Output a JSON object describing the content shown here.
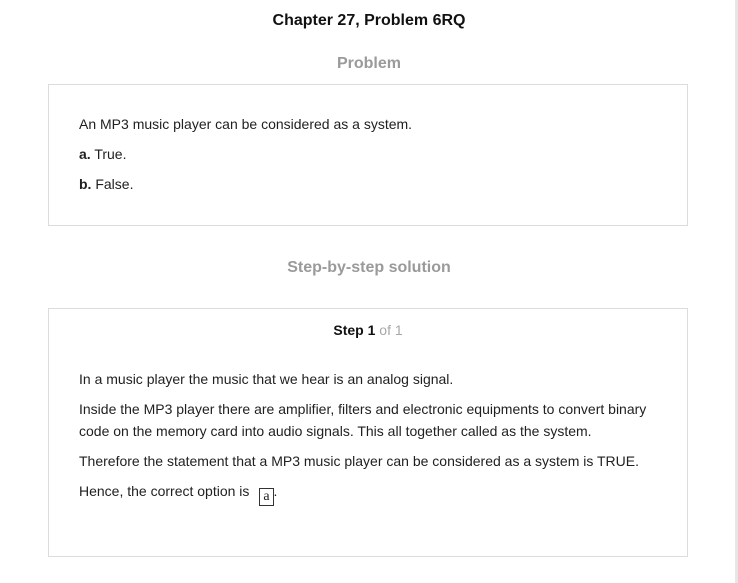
{
  "header": {
    "title": "Chapter 27, Problem 6RQ"
  },
  "problem": {
    "heading": "Problem",
    "question": "An MP3 music player can be considered as a system.",
    "options": [
      {
        "letter": "a.",
        "text": "True."
      },
      {
        "letter": "b.",
        "text": "False."
      }
    ]
  },
  "solution": {
    "heading": "Step-by-step solution",
    "step": {
      "word": "Step",
      "number": "1",
      "of_text": "of 1"
    },
    "paragraphs": [
      "In a music player the music that we hear is an analog signal.",
      "Inside the MP3 player there are amplifier, filters and electronic equipments to convert binary code on the memory card into audio signals. This all together called as the system.",
      "Therefore the statement that a MP3 music player can be considered as a system is TRUE."
    ],
    "conclusion_prefix": "Hence, the correct option is",
    "answer": "a",
    "conclusion_suffix": "."
  }
}
